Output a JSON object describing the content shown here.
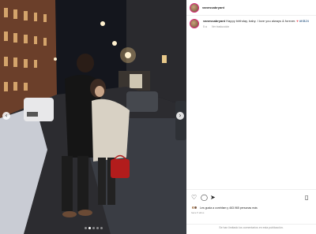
{
  "post": {
    "username": "vanessabryant",
    "caption": {
      "username": "vanessabryant",
      "text": "Happy birthday, baby. I love you always & forever.",
      "hashtag": "#KB24"
    },
    "caption_meta": {
      "age": "5 a",
      "translate": "Ver traducción"
    },
    "likes_text": "Les gusta a comhfam y 463.965 personas más",
    "time": "hace 5 años",
    "comments_disabled": "Se han limitado los comentarios en esta publicación."
  },
  "icons": {
    "like": "heart-outline-icon",
    "comment": "comment-bubble-icon",
    "share": "paper-plane-icon",
    "save": "bookmark-icon",
    "prev": "chevron-left-icon",
    "next": "chevron-right-icon"
  },
  "carousel": {
    "count": 5,
    "active_index": 1
  },
  "colors": {
    "link": "#00376b",
    "heart": "#ed4956",
    "meta": "#8e8e8e"
  }
}
